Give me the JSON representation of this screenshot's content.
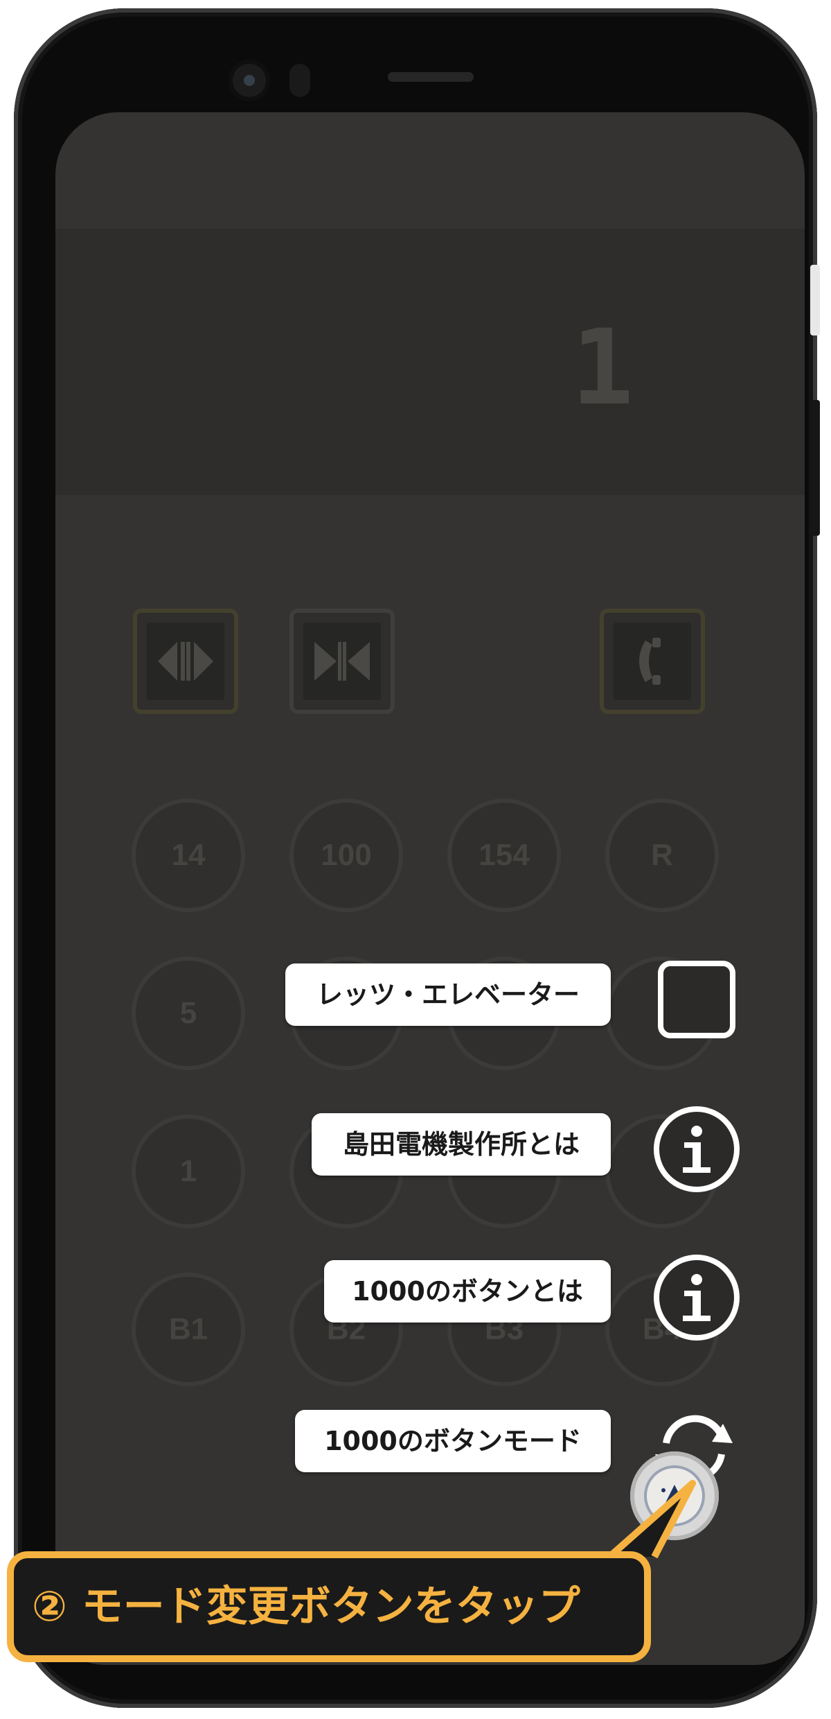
{
  "display": {
    "floor": "1"
  },
  "controls": {
    "door_open_icon": "door-open-icon",
    "door_close_icon": "door-close-icon",
    "phone_icon": "phone-icon"
  },
  "floor_buttons": [
    [
      "14",
      "100",
      "154",
      "R"
    ],
    [
      "5",
      "",
      "",
      ""
    ],
    [
      "1",
      "",
      "",
      ""
    ],
    [
      "B1",
      "B2",
      "B3",
      "B4"
    ]
  ],
  "menu": {
    "items": [
      {
        "label": "レッツ・エレベーター",
        "icon": "square-icon"
      },
      {
        "label": "島田電機製作所とは",
        "icon": "info-icon"
      },
      {
        "label": "1000のボタンとは",
        "icon": "info-icon"
      },
      {
        "label": "1000のボタンモード",
        "icon": "refresh-icon"
      }
    ],
    "fab_icon": "up-arrow-icon"
  },
  "callout": {
    "text": "② モード変更ボタンをタップ",
    "color": "#f5b240"
  }
}
